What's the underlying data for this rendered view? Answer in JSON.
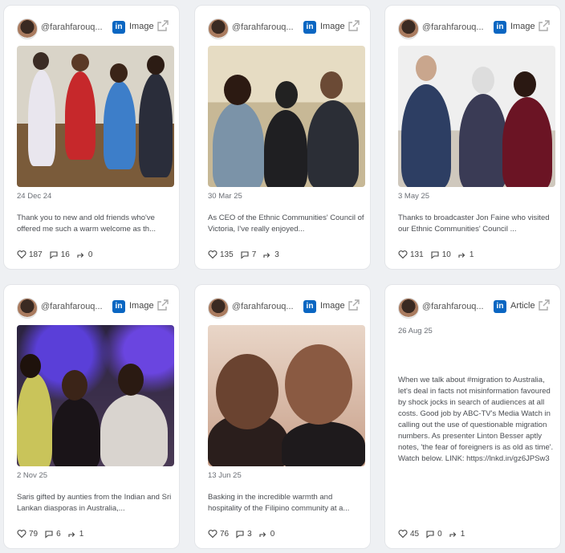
{
  "cards": [
    {
      "handle": "@farahfarouq...",
      "type": "Image",
      "date": "24 Dec 24",
      "text": "Thank you to new and old friends who've offered me such a warm welcome as th...",
      "likes": "187",
      "comments": "16",
      "shares": "0"
    },
    {
      "handle": "@farahfarouq...",
      "type": "Image",
      "date": "30 Mar 25",
      "text": "As CEO of the Ethnic Communities' Council of Victoria, I've really enjoyed...",
      "likes": "135",
      "comments": "7",
      "shares": "3"
    },
    {
      "handle": "@farahfarouq...",
      "type": "Image",
      "date": "3 May 25",
      "text": "Thanks to broadcaster Jon Faine who visited our Ethnic Communities' Council ...",
      "likes": "131",
      "comments": "10",
      "shares": "1"
    },
    {
      "handle": "@farahfarouq...",
      "type": "Image",
      "date": "2 Nov 25",
      "text": "Saris gifted by aunties from the Indian and Sri Lankan diasporas in Australia,...",
      "likes": "79",
      "comments": "6",
      "shares": "1"
    },
    {
      "handle": "@farahfarouq...",
      "type": "Image",
      "date": "13 Jun 25",
      "text": "Basking in the incredible warmth and hospitality of the Filipino community at a...",
      "likes": "76",
      "comments": "3",
      "shares": "0"
    },
    {
      "handle": "@farahfarouq...",
      "type": "Article",
      "date": "26 Aug 25",
      "text": "When we talk about #migration to Australia, let's deal in facts not misinformation favoured by shock jocks in search of audiences at all costs. Good job by ABC-TV's Media Watch in calling out the use of questionable migration numbers. As presenter Linton Besser aptly notes, 'the fear of foreigners is as old as time'. Watch below. LINK: https://lnkd.in/gz6JPSw3",
      "likes": "45",
      "comments": "0",
      "shares": "1"
    }
  ],
  "icons": {
    "linkedin": "in",
    "external": "external-link-icon",
    "like": "heart-icon",
    "comment": "comment-icon",
    "share": "share-icon"
  }
}
